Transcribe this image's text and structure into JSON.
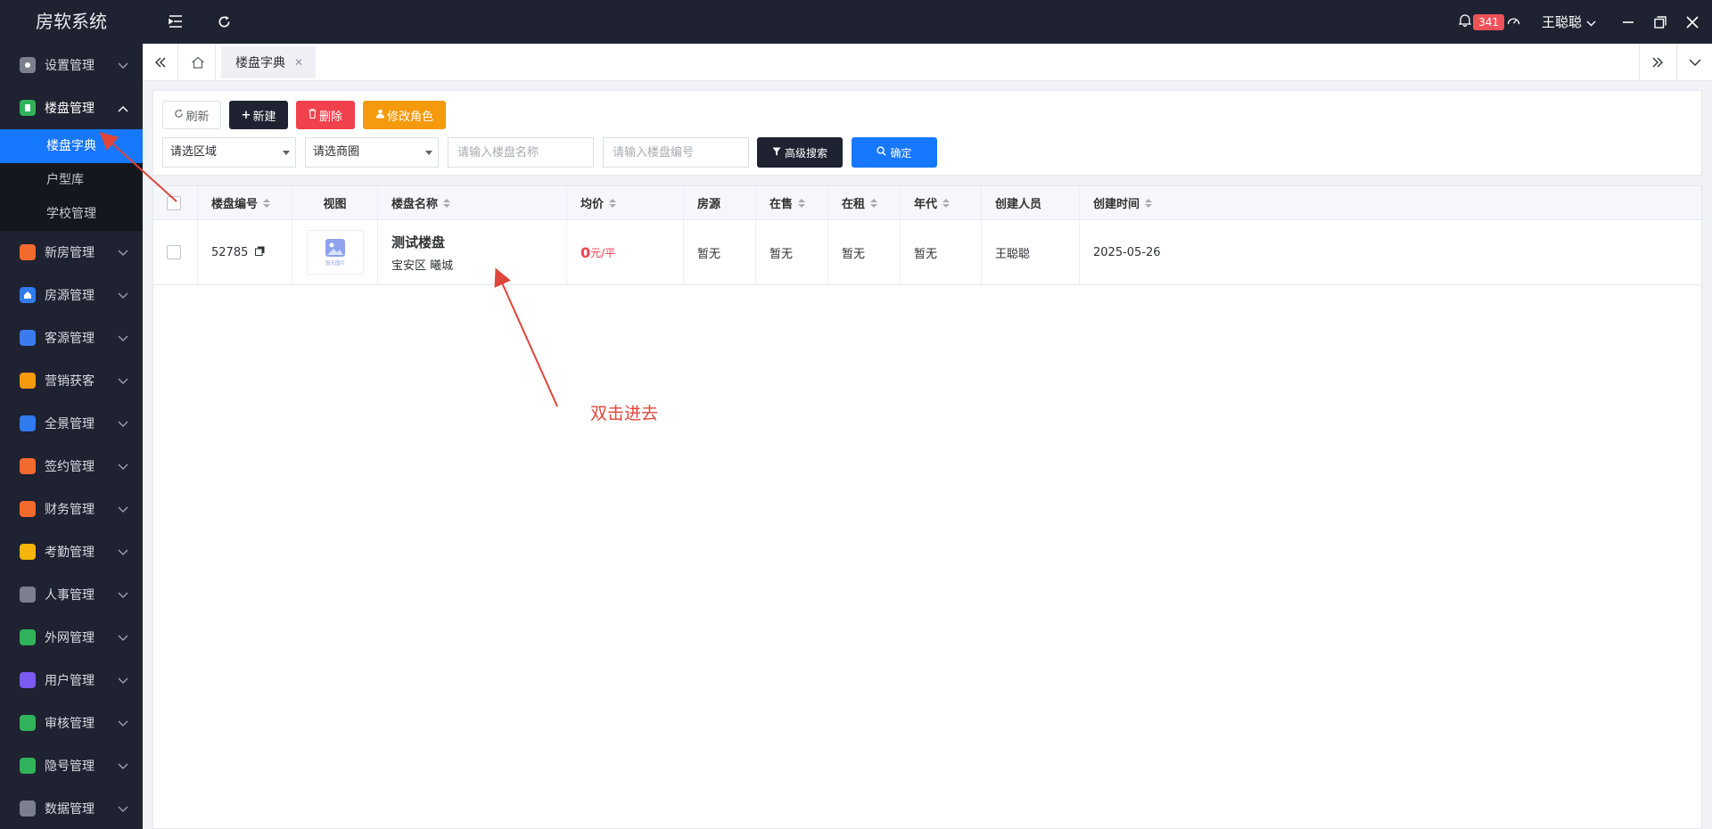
{
  "app": {
    "title": "房软系统"
  },
  "header": {
    "notification_count": "341",
    "user_name": "王聪聪"
  },
  "sidebar": {
    "items": [
      {
        "label": "设置管理",
        "icon": "settings-icon",
        "color": "#7c7f8c"
      },
      {
        "label": "楼盘管理",
        "icon": "building-icon",
        "color": "#2fb35b",
        "expanded": true,
        "children": [
          {
            "label": "楼盘字典",
            "active": true
          },
          {
            "label": "户型库"
          },
          {
            "label": "学校管理"
          }
        ]
      },
      {
        "label": "新房管理",
        "icon": "newhouse-icon",
        "color": "#f26a2e"
      },
      {
        "label": "房源管理",
        "icon": "home-icon",
        "color": "#2f7bf0"
      },
      {
        "label": "客源管理",
        "icon": "customer-icon",
        "color": "#3a7bf0"
      },
      {
        "label": "营销获客",
        "icon": "share-icon",
        "color": "#f59a0c"
      },
      {
        "label": "全景管理",
        "icon": "panorama-icon",
        "color": "#2f7bf0"
      },
      {
        "label": "签约管理",
        "icon": "contract-icon",
        "color": "#f26a2e"
      },
      {
        "label": "财务管理",
        "icon": "finance-icon",
        "color": "#f26a2e"
      },
      {
        "label": "考勤管理",
        "icon": "attendance-icon",
        "color": "#f5b50c"
      },
      {
        "label": "人事管理",
        "icon": "hr-icon",
        "color": "#7c7f8c"
      },
      {
        "label": "外网管理",
        "icon": "web-icon",
        "color": "#2fb35b"
      },
      {
        "label": "用户管理",
        "icon": "user-icon",
        "color": "#7a5af0"
      },
      {
        "label": "审核管理",
        "icon": "audit-icon",
        "color": "#2fb35b"
      },
      {
        "label": "隐号管理",
        "icon": "phone-icon",
        "color": "#2fb35b"
      },
      {
        "label": "数据管理",
        "icon": "data-icon",
        "color": "#7c7f8c"
      }
    ]
  },
  "tabs": [
    {
      "label": "楼盘字典"
    }
  ],
  "toolbar": {
    "refresh": "刷新",
    "new": "新建",
    "delete": "删除",
    "role": "修改角色",
    "region_select": "请选区域",
    "circle_select": "请选商圈",
    "name_placeholder": "请输入楼盘名称",
    "code_placeholder": "请输入楼盘编号",
    "advanced": "高级搜索",
    "confirm": "确定"
  },
  "table": {
    "columns": [
      "楼盘编号",
      "视图",
      "楼盘名称",
      "均价",
      "房源",
      "在售",
      "在租",
      "年代",
      "创建人员",
      "创建时间"
    ],
    "rows": [
      {
        "code": "52785",
        "thumb_text": "暂无图片",
        "name": "测试楼盘",
        "district": "宝安区 曦城",
        "price": "0",
        "price_unit": "元/平",
        "listings": "暂无",
        "on_sale": "暂无",
        "on_rent": "暂无",
        "year": "暂无",
        "creator": "王聪聪",
        "created_at": "2025-05-26"
      }
    ]
  },
  "annotation": {
    "text": "双击进去",
    "color": "#e0453a"
  }
}
